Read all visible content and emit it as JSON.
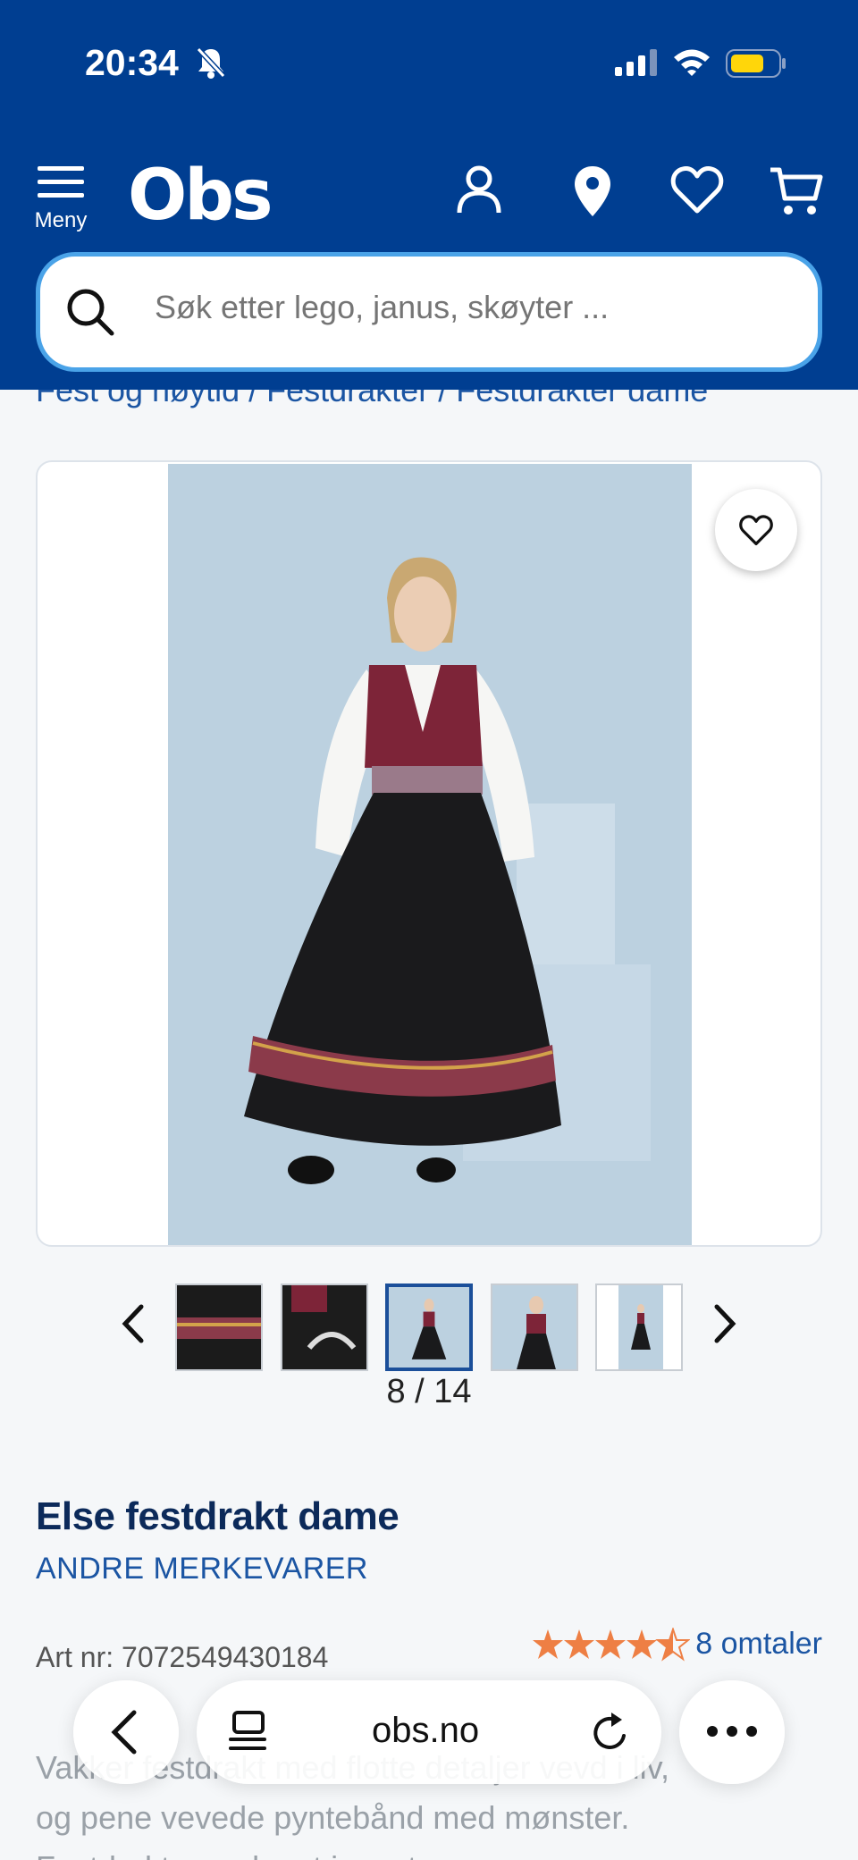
{
  "status": {
    "time": "20:34"
  },
  "header": {
    "menu_label": "Meny",
    "logo": "Obs",
    "search_placeholder": "Søk etter lego, janus, skøyter ...",
    "brand_color": "#003e91"
  },
  "breadcrumb": [
    "Fest og høytid",
    "Festdrakter",
    "Festdrakter dame"
  ],
  "gallery": {
    "counter": "8 / 14"
  },
  "product": {
    "title": "Else festdrakt dame",
    "brand": "ANDRE MERKEVARER",
    "article": "Art nr: 7072549430184",
    "rating": 4.5,
    "reviews": "8 omtaler",
    "description_line1": "Vakker festdrakt med flotte detaljer vevd i liv,",
    "description_line2": "og pene vevede pyntebånd med mønster.",
    "description_line3": "Festdrakten er laget i svart ..."
  },
  "browser": {
    "url": "obs.no"
  }
}
